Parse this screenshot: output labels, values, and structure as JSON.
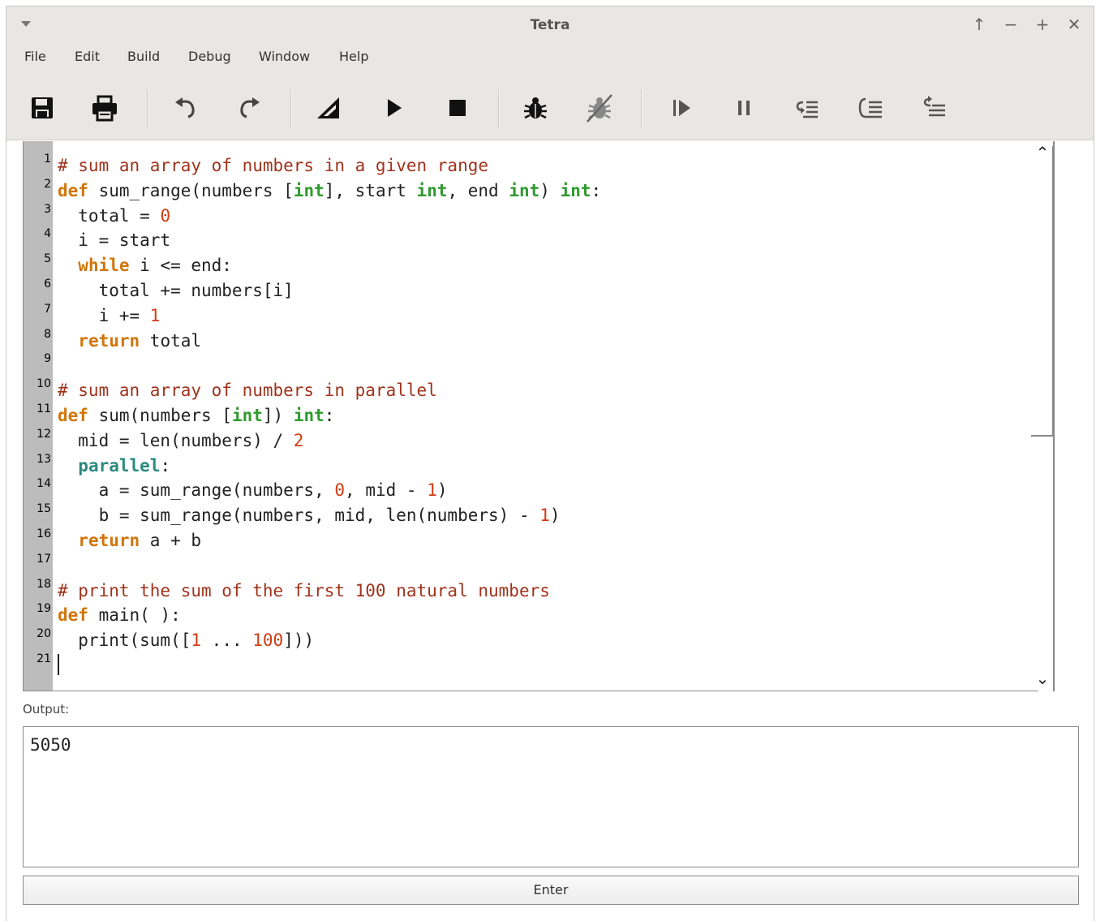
{
  "window": {
    "title": "Tetra"
  },
  "menu": [
    "File",
    "Edit",
    "Build",
    "Debug",
    "Window",
    "Help"
  ],
  "toolbar_icons": [
    "save-icon",
    "print-icon",
    "undo-icon",
    "redo-icon",
    "build-icon",
    "run-icon",
    "stop-icon",
    "debug-icon",
    "stop-debug-icon",
    "continue-icon",
    "pause-icon",
    "step-icon",
    "step-into-icon",
    "step-out-icon"
  ],
  "editor": {
    "lines": [
      {
        "n": "1",
        "html": "<span class=\"cm\"># sum an array of numbers in a given range</span>"
      },
      {
        "n": "2",
        "html": "<span class=\"kw\">def</span> sum_range(numbers [<span class=\"ty\">int</span>], start <span class=\"ty\">int</span>, end <span class=\"ty\">int</span>) <span class=\"ty\">int</span>:"
      },
      {
        "n": "3",
        "html": "  total = <span class=\"nm\">0</span>"
      },
      {
        "n": "4",
        "html": "  i = start"
      },
      {
        "n": "5",
        "html": "  <span class=\"kw\">while</span> i &lt;= end:"
      },
      {
        "n": "6",
        "html": "    total += numbers[i]"
      },
      {
        "n": "7",
        "html": "    i += <span class=\"nm\">1</span>"
      },
      {
        "n": "8",
        "html": "  <span class=\"kw\">return</span> total"
      },
      {
        "n": "9",
        "html": ""
      },
      {
        "n": "10",
        "html": "<span class=\"cm\"># sum an array of numbers in parallel</span>"
      },
      {
        "n": "11",
        "html": "<span class=\"kw\">def</span> sum(numbers [<span class=\"ty\">int</span>]) <span class=\"ty\">int</span>:"
      },
      {
        "n": "12",
        "html": "  mid = len(numbers) / <span class=\"nm\">2</span>"
      },
      {
        "n": "13",
        "html": "  <span class=\"pl\">parallel</span>:"
      },
      {
        "n": "14",
        "html": "    a = sum_range(numbers, <span class=\"nm\">0</span>, mid - <span class=\"nm\">1</span>)"
      },
      {
        "n": "15",
        "html": "    b = sum_range(numbers, mid, len(numbers) - <span class=\"nm\">1</span>)"
      },
      {
        "n": "16",
        "html": "  <span class=\"kw\">return</span> a + b"
      },
      {
        "n": "17",
        "html": ""
      },
      {
        "n": "18",
        "html": "<span class=\"cm\"># print the sum of the first 100 natural numbers</span>"
      },
      {
        "n": "19",
        "html": "<span class=\"kw\">def</span> main( ):"
      },
      {
        "n": "20",
        "html": "  print(sum([<span class=\"nm\">1</span> ... <span class=\"nm\">100</span>]))"
      },
      {
        "n": "21",
        "html": ""
      }
    ]
  },
  "output": {
    "label": "Output:",
    "text": "5050"
  },
  "enter_button": {
    "label": "Enter"
  },
  "colors": {
    "comment": "#a0331c",
    "keyword": "#d1750a",
    "type": "#2f9a2f",
    "number": "#d13b14",
    "parallel": "#2a8a80"
  }
}
